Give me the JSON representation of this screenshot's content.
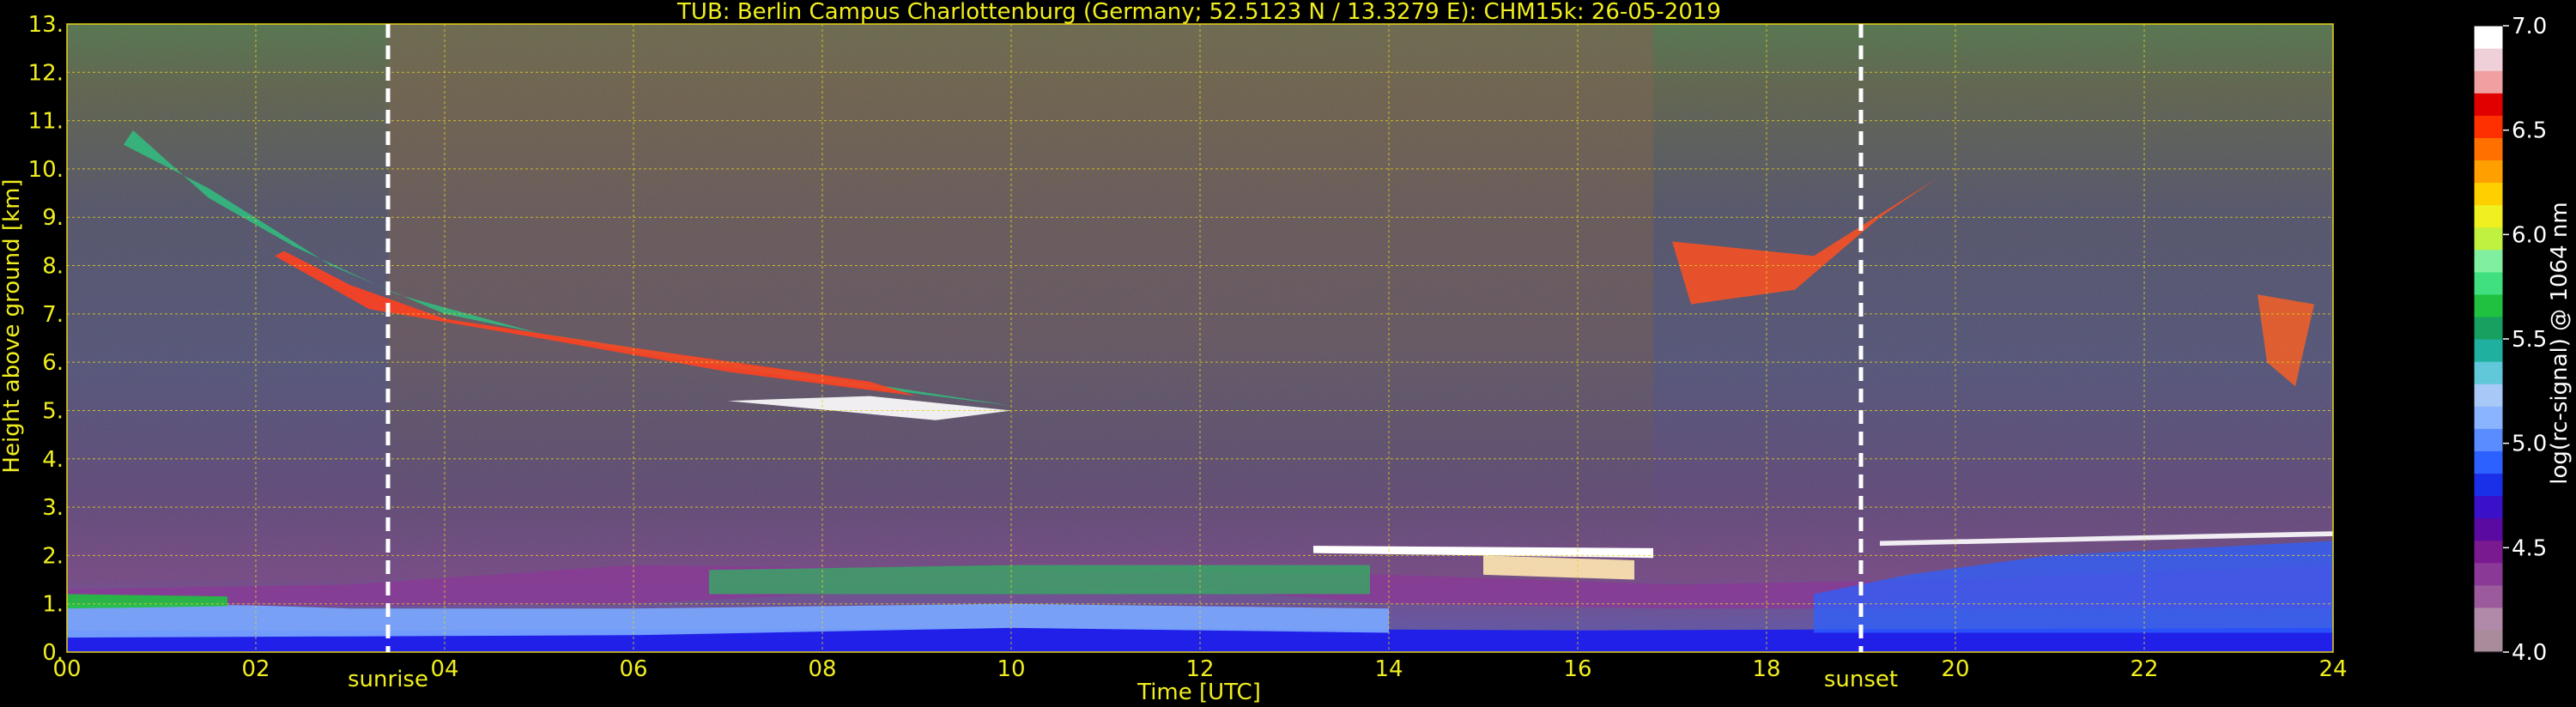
{
  "chart_data": {
    "type": "heatmap",
    "title": "TUB: Berlin Campus Charlottenburg (Germany; 52.5123 N / 13.3279 E):    CHM15k: 26-05-2019",
    "xlabel": "Time [UTC]",
    "ylabel": "Height above ground [km]",
    "xlim": [
      0,
      24
    ],
    "ylim": [
      0,
      13
    ],
    "xticks": [
      "00",
      "02",
      "04",
      "06",
      "08",
      "10",
      "12",
      "14",
      "16",
      "18",
      "20",
      "22",
      "24"
    ],
    "yticks": [
      "0.",
      "1.",
      "2.",
      "3.",
      "4.",
      "5.",
      "6.",
      "7.",
      "8.",
      "9.",
      "10.",
      "11.",
      "12.",
      "13."
    ],
    "grid": true,
    "colorbar": {
      "label": "log(rc-signal) @ 1064 nm",
      "range": [
        4.0,
        7.0
      ],
      "ticks": [
        "4.0",
        "4.5",
        "5.0",
        "5.5",
        "6.0",
        "6.5",
        "7.0"
      ],
      "colors": [
        "#a88c9c",
        "#b08aa8",
        "#9a5a9c",
        "#8a3a96",
        "#7a1a90",
        "#5a0aa0",
        "#3a10c8",
        "#1a30e8",
        "#2c60ff",
        "#5a8cff",
        "#8ab4ff",
        "#a8c8f8",
        "#60c8d8",
        "#20b0a0",
        "#18a060",
        "#20c040",
        "#40e080",
        "#80f0a0",
        "#c0f040",
        "#f0f020",
        "#ffd000",
        "#ffa000",
        "#ff7000",
        "#ff3000",
        "#e00000",
        "#f0a0a0",
        "#f0d0d8",
        "#ffffff"
      ]
    },
    "annotations": [
      {
        "text": "sunrise",
        "x": 3.4
      },
      {
        "text": "sunset",
        "x": 19.0
      }
    ]
  },
  "colors": {
    "text": "#f0ee1e",
    "colorbar_text": "#ffffff",
    "grid": "#e8d21a",
    "background": "#000000",
    "marker_line": "#ffffff"
  }
}
